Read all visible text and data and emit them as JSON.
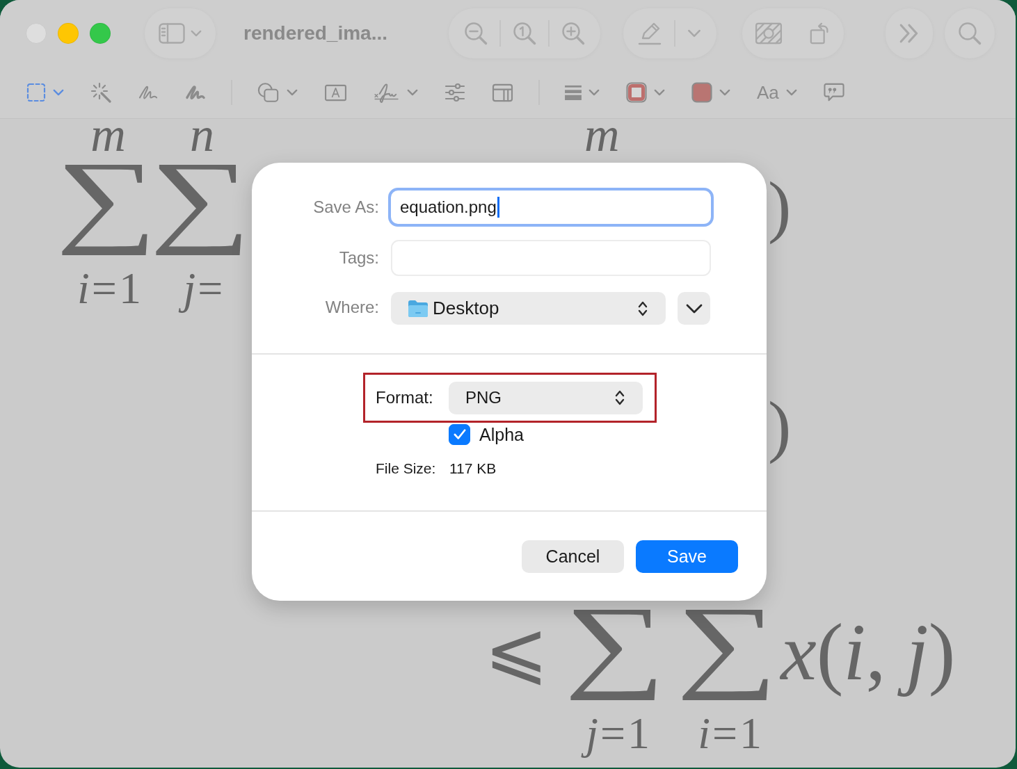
{
  "window": {
    "title": "rendered_ima...",
    "traffic_lights": [
      {
        "kind": "close",
        "disabled": true
      },
      {
        "kind": "minimize",
        "disabled": false
      },
      {
        "kind": "zoom",
        "disabled": false
      }
    ]
  },
  "toolbar": {
    "leading": [
      {
        "items": [
          {
            "kind": "sidebar",
            "menu": true
          }
        ]
      }
    ],
    "trailing": [
      {
        "divided": true,
        "items": [
          {
            "kind": "zoom-out"
          },
          {
            "kind": "actual-size"
          },
          {
            "kind": "zoom-in"
          }
        ]
      },
      {
        "divided": true,
        "items": [
          {
            "kind": "markup"
          },
          {
            "kind": "menu"
          }
        ]
      },
      {
        "divided": false,
        "items": [
          {
            "kind": "adjust"
          },
          {
            "kind": "rotate"
          }
        ]
      },
      {
        "items": [
          {
            "kind": "more"
          }
        ]
      },
      {
        "items": [
          {
            "kind": "search"
          }
        ]
      }
    ]
  },
  "markup_toolbar": {
    "groups": [
      {
        "tools": [
          {
            "kind": "select",
            "menu": true,
            "selected": true
          },
          {
            "kind": "instant-alpha",
            "menu": false,
            "selected": false
          },
          {
            "kind": "sketch",
            "menu": false,
            "selected": false
          },
          {
            "kind": "draw",
            "menu": false,
            "selected": false
          }
        ]
      },
      {
        "tools": [
          {
            "kind": "shapes",
            "menu": true,
            "selected": false
          },
          {
            "kind": "text",
            "menu": false,
            "selected": false
          },
          {
            "kind": "sign",
            "menu": true,
            "selected": false
          },
          {
            "kind": "adjust-color",
            "menu": false,
            "selected": false
          },
          {
            "kind": "page-layout",
            "menu": false,
            "selected": false
          }
        ]
      },
      {
        "tools": [
          {
            "kind": "shape-style",
            "menu": true,
            "selected": false
          },
          {
            "kind": "border-color",
            "menu": true,
            "selected": false,
            "color": "#bd6f6d"
          },
          {
            "kind": "fill-color",
            "menu": true,
            "selected": false,
            "color": "#b97572"
          },
          {
            "kind": "text-style",
            "label": "Aa",
            "menu": true,
            "selected": false
          },
          {
            "kind": "annotate",
            "menu": false,
            "selected": false
          }
        ]
      }
    ]
  },
  "image": {
    "top_sums": [
      {
        "upper": "m",
        "symbol": "∑",
        "lower": "*i*=1"
      },
      {
        "upper": "n",
        "symbol": "∑",
        "lower": "*j*="
      }
    ],
    "top_limit": "m",
    "parens": [
      ")",
      ")"
    ],
    "relation": "⩽",
    "bottom_sums": [
      {
        "symbol": "∑",
        "lower": "*j*=1"
      },
      {
        "symbol": "∑",
        "lower": "*i*=1"
      }
    ],
    "term": "*x*(*i*, *j*)"
  },
  "save_dialog": {
    "save_as": {
      "label": "Save As:",
      "value": "equation.png",
      "focused": true
    },
    "tags": {
      "label": "Tags:"
    },
    "where": {
      "label": "Where:",
      "value": "Desktop",
      "expanded": false
    },
    "format": {
      "label": "Format:",
      "value": "PNG",
      "highlighted": true
    },
    "alpha": {
      "label": "Alpha",
      "checked": true
    },
    "file_size": {
      "label": "File Size:",
      "value": "117 KB"
    },
    "buttons": [
      {
        "label": "Cancel",
        "kind": "secondary"
      },
      {
        "label": "Save",
        "kind": "primary"
      }
    ]
  }
}
